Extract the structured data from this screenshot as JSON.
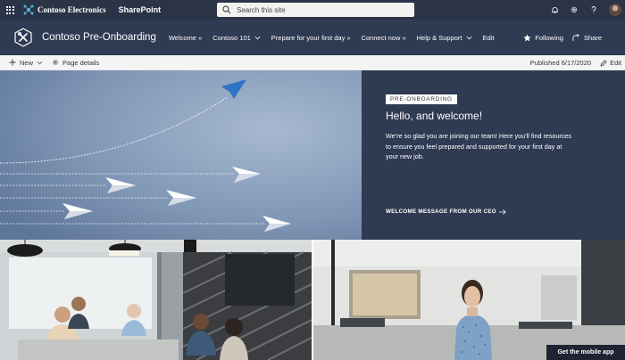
{
  "suite": {
    "brand_name": "Contoso Electronics",
    "app_name": "SharePoint",
    "search_placeholder": "Search this site"
  },
  "site": {
    "title": "Contoso Pre-Onboarding",
    "nav": [
      {
        "label": "Welcome »",
        "has_dropdown": false
      },
      {
        "label": "Contoso 101",
        "has_dropdown": true
      },
      {
        "label": "Prepare for your first day »",
        "has_dropdown": false
      },
      {
        "label": "Connect now »",
        "has_dropdown": false
      },
      {
        "label": "Help & Support",
        "has_dropdown": true
      },
      {
        "label": "Edit",
        "has_dropdown": false
      }
    ],
    "following_label": "Following",
    "share_label": "Share"
  },
  "commandbar": {
    "new_label": "New",
    "page_details_label": "Page details",
    "published": "Published 6/17/2020",
    "edit_label": "Edit"
  },
  "hero": {
    "tag": "PRE-ONBOARDING",
    "title": "Hello, and welcome!",
    "text": "We’re so glad you are joining our team! Here you’ll find resources to ensure you feel prepared and supported for your first day at your new job.",
    "link": "WELCOME MESSAGE FROM OUR CEO"
  },
  "tiles": {
    "mobile_app_label": "Get the mobile app"
  },
  "colors": {
    "suitebar": "#2b3346",
    "header": "#2f3a53",
    "accent_blue": "#2f73c6"
  },
  "icons": {
    "waffle": "app-launcher-icon",
    "brand": "contoso-logo-icon",
    "search": "search-icon",
    "bell": "bell-icon",
    "settings": "gear-icon",
    "help": "help-icon",
    "site_logo": "tools-icon",
    "star": "star-icon",
    "share": "share-icon",
    "plus": "plus-icon",
    "page_details": "gear-icon",
    "edit": "pencil-icon"
  }
}
